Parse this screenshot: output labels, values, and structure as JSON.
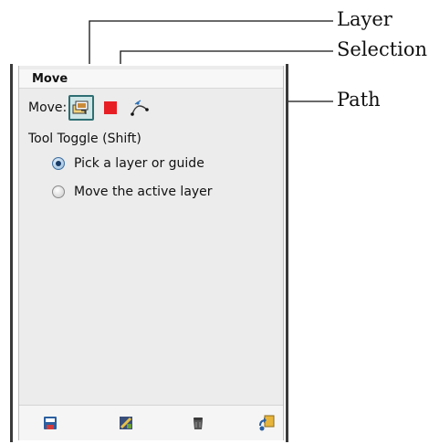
{
  "panel": {
    "title": "Move",
    "move_label": "Move:",
    "modes": [
      {
        "name": "layer",
        "icon": "layer-icon",
        "active": true
      },
      {
        "name": "selection",
        "icon": "selection-icon",
        "active": false
      },
      {
        "name": "path",
        "icon": "path-icon",
        "active": false
      }
    ],
    "tool_toggle_heading": "Tool Toggle (Shift)",
    "options": [
      {
        "label": "Pick a layer or guide",
        "checked": true
      },
      {
        "label": "Move the active layer",
        "checked": false
      }
    ],
    "bottom_buttons": [
      "save-preset-icon",
      "restore-preset-icon",
      "delete-preset-icon",
      "reset-icon"
    ]
  },
  "callouts": {
    "layer": "Layer",
    "selection": "Selection",
    "path": "Path"
  },
  "colors": {
    "selection_red": "#e81e25",
    "active_border": "#2e6f73",
    "radio_checked": "#173a66"
  }
}
